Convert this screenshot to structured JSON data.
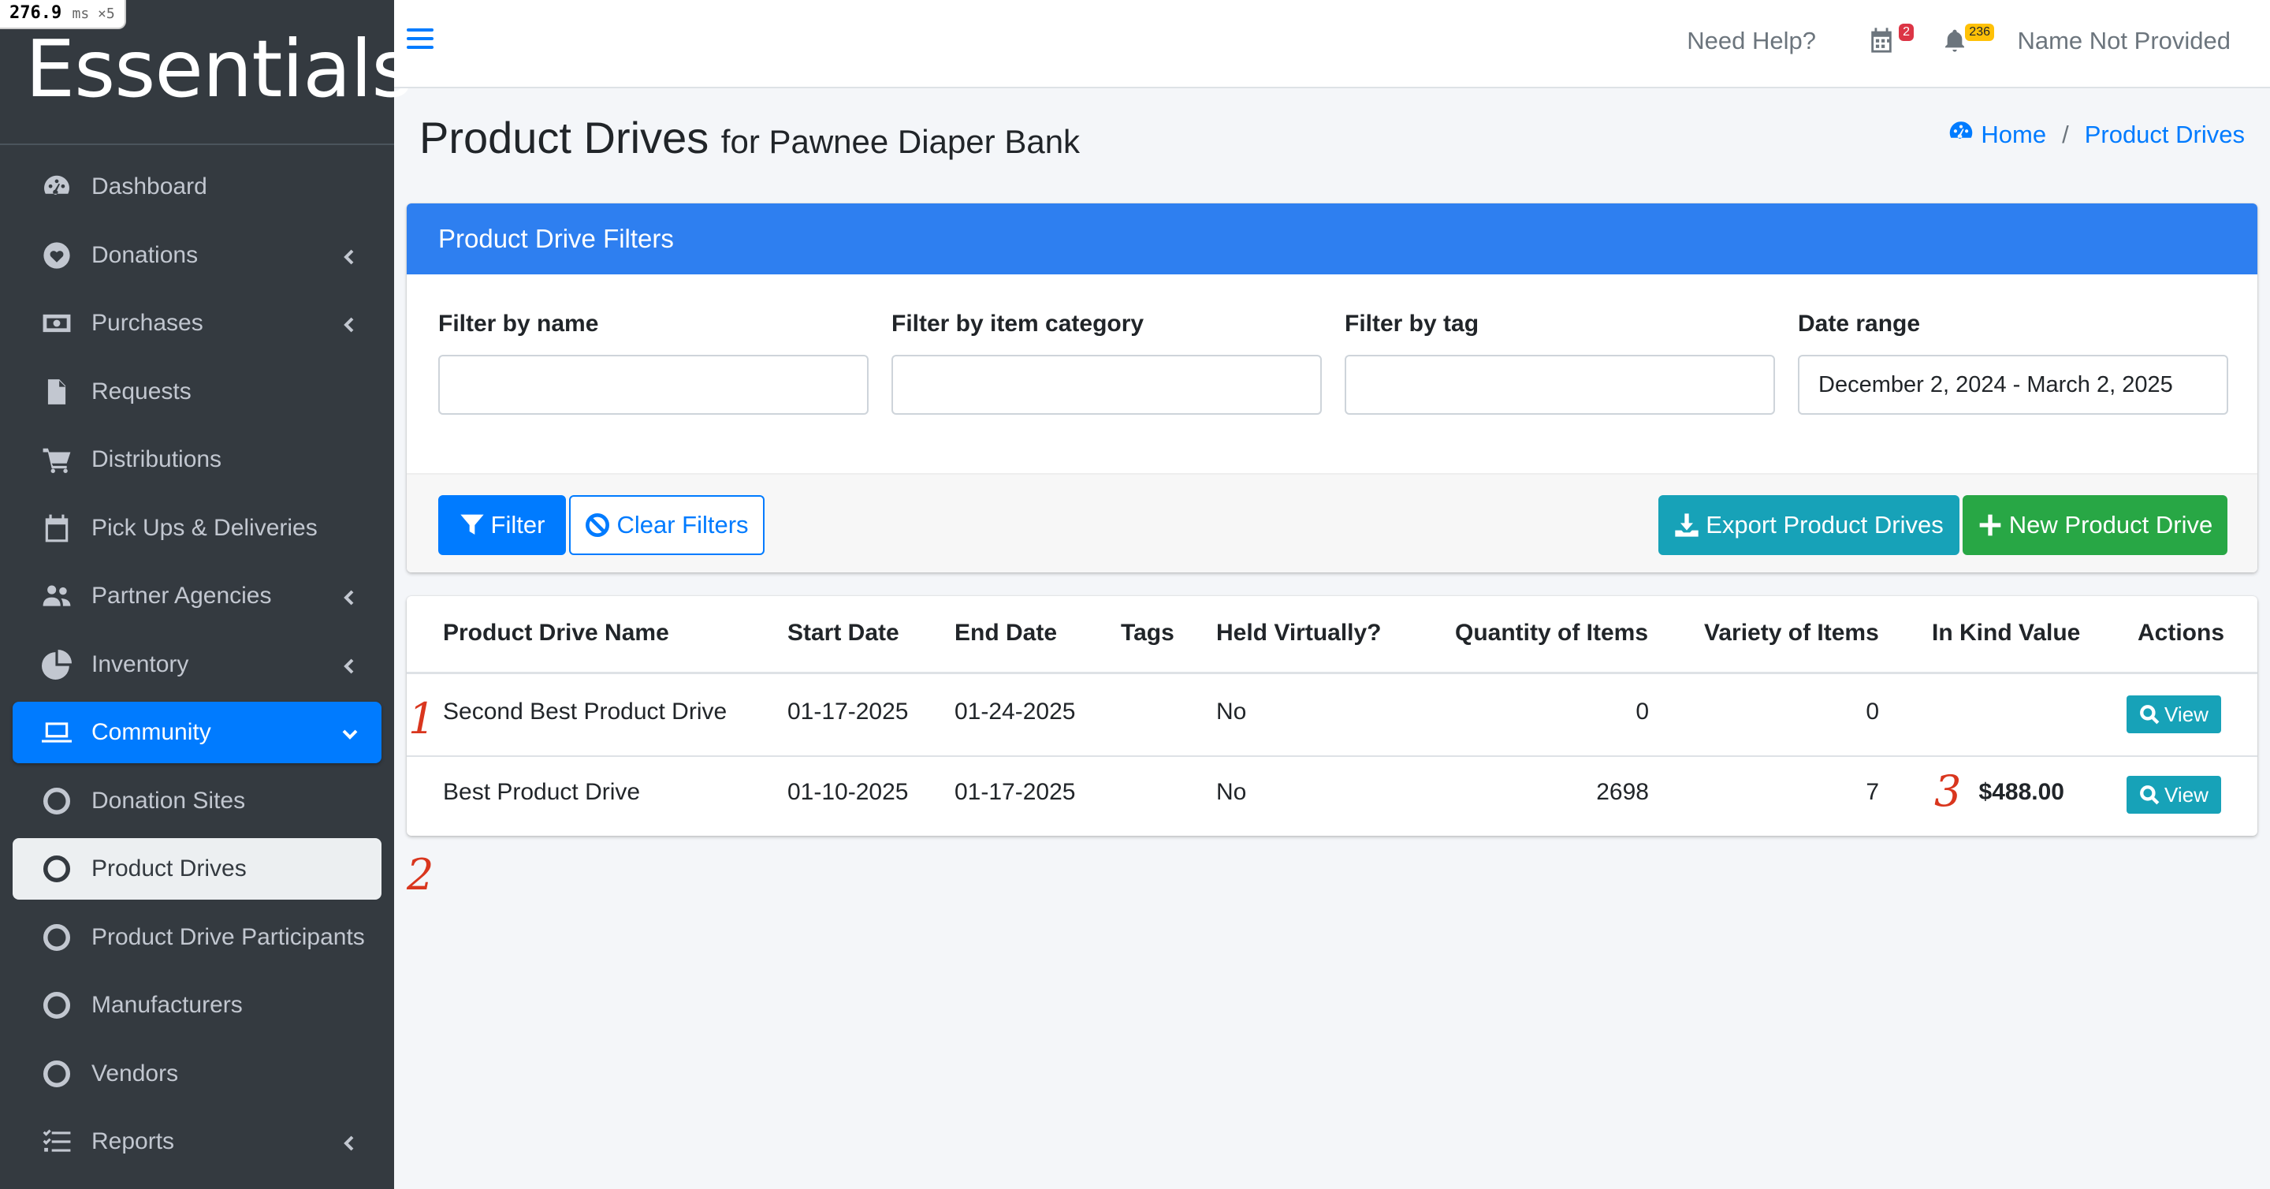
{
  "perf": {
    "value": "276.9",
    "unit": "ms ×5"
  },
  "brand": "Essentials",
  "sidebar": {
    "items": [
      {
        "label": "Dashboard",
        "icon": "dashboard-icon"
      },
      {
        "label": "Donations",
        "icon": "heart-icon"
      },
      {
        "label": "Purchases",
        "icon": "money-icon"
      },
      {
        "label": "Requests",
        "icon": "file-icon"
      },
      {
        "label": "Distributions",
        "icon": "cart-icon"
      },
      {
        "label": "Pick Ups & Deliveries",
        "icon": "calendar-icon"
      },
      {
        "label": "Partner Agencies",
        "icon": "users-icon"
      },
      {
        "label": "Inventory",
        "icon": "pie-chart-icon"
      },
      {
        "label": "Community",
        "icon": "laptop-icon"
      },
      {
        "label": "Donation Sites",
        "icon": "circle-icon"
      },
      {
        "label": "Product Drives",
        "icon": "circle-icon"
      },
      {
        "label": "Product Drive Participants",
        "icon": "circle-icon"
      },
      {
        "label": "Manufacturers",
        "icon": "circle-icon"
      },
      {
        "label": "Vendors",
        "icon": "circle-icon"
      },
      {
        "label": "Reports",
        "icon": "list-check-icon"
      }
    ]
  },
  "topbar": {
    "help": "Need Help?",
    "calendar_badge": "2",
    "bell_badge": "236",
    "user": "Name Not Provided"
  },
  "header": {
    "title": "Product Drives",
    "subtitle": "for Pawnee Diaper Bank",
    "breadcrumb": {
      "home": "Home",
      "current": "Product Drives",
      "separator": "/"
    }
  },
  "filters": {
    "title": "Product Drive Filters",
    "name_label": "Filter by name",
    "name_value": "",
    "category_label": "Filter by item category",
    "category_value": "",
    "tag_label": "Filter by tag",
    "tag_value": "",
    "date_label": "Date range",
    "date_value": "December 2, 2024 - March 2, 2025",
    "filter_button": "Filter",
    "clear_button": "Clear Filters",
    "export_button": "Export Product Drives",
    "new_button": "New Product Drive"
  },
  "table": {
    "columns": [
      "Product Drive Name",
      "Start Date",
      "End Date",
      "Tags",
      "Held Virtually?",
      "Quantity of Items",
      "Variety of Items",
      "In Kind Value",
      "Actions"
    ],
    "rows": [
      {
        "name": "Second Best Product Drive",
        "start": "01-17-2025",
        "end": "01-24-2025",
        "tags": "",
        "virtual": "No",
        "quantity": "0",
        "variety": "0",
        "value": "",
        "action": "View"
      },
      {
        "name": "Best Product Drive",
        "start": "01-10-2025",
        "end": "01-17-2025",
        "tags": "",
        "virtual": "No",
        "quantity": "2698",
        "variety": "7",
        "value": "$488.00",
        "action": "View"
      }
    ]
  },
  "annotations": [
    "1",
    "2",
    "3"
  ],
  "colors": {
    "sidebar": "#343a40",
    "primary": "#007bff",
    "info": "#17a2b8",
    "success": "#28a745",
    "annotation": "#d9361e"
  }
}
